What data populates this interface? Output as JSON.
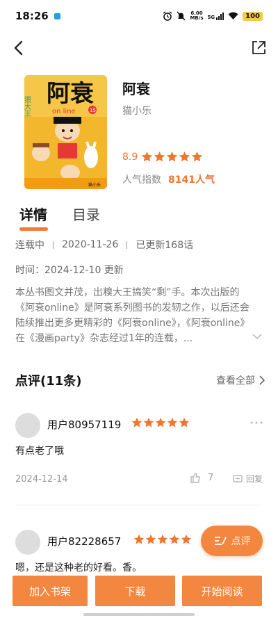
{
  "status_bar": {
    "time": "18:26",
    "net_speed_value": "6.00",
    "net_speed_unit": "MB/s",
    "network": "5G",
    "battery": "100"
  },
  "book": {
    "title": "阿衰",
    "author": "猫小乐",
    "rating": "8.9",
    "stars_filled": 5,
    "popularity_label": "人气指数",
    "popularity_value": "8141人气",
    "cover": {
      "title_text": "阿衰",
      "subtitle": "on line",
      "volume": "15",
      "side_text": "猥大王",
      "publisher": "猫小乐",
      "colors": {
        "bg": "#f2b72c",
        "title": "#111111",
        "accent": "#e53935"
      }
    }
  },
  "tabs": [
    {
      "label": "详情",
      "active": true
    },
    {
      "label": "目录",
      "active": false
    }
  ],
  "meta": {
    "status": "连载中",
    "date": "2020-11-26",
    "updated": "已更新168话",
    "time_line": "时间：2024-12-10 更新"
  },
  "description": "本丛书图文并茂，出糗大王搞笑“剩”手。本次出版的《阿衰online》是阿衰系列图书的发轫之作，以后还会陆续推出更多更精彩的《阿衰online》，《阿衰online》在《漫画party》杂志经过1年的连载，...",
  "comments": {
    "header": "点评(11条)",
    "view_all": "查看全部",
    "items": [
      {
        "user": "用户80957119",
        "stars": 5,
        "text": "有点老了哦",
        "date": "2024-12-14",
        "likes": "7",
        "reply_label": "回复"
      },
      {
        "user": "用户82228657",
        "stars": 5,
        "text": "嗯，还是这种老的好看。香。"
      }
    ]
  },
  "fab_label": "点评",
  "bottom_bar": {
    "add_shelf": "加入书架",
    "download": "下载",
    "read": "开始阅读"
  },
  "colors": {
    "accent": "#f48740",
    "star": "#f0752e",
    "muted": "#888888"
  }
}
